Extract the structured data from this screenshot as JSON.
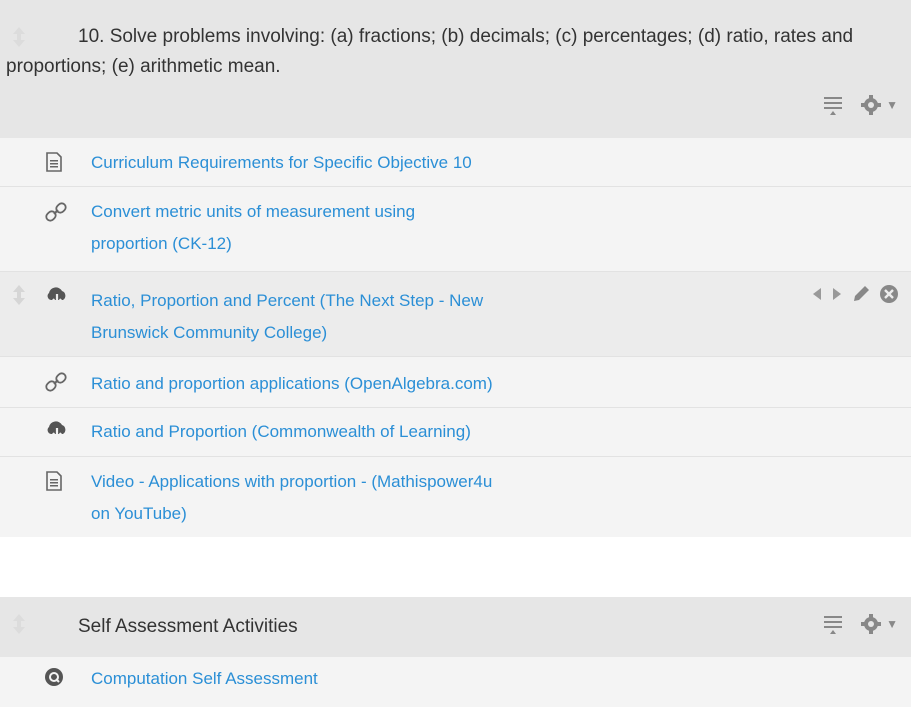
{
  "section1": {
    "title": "10. Solve problems involving: (a) fractions; (b) decimals; (c) percentages; (d) ratio, rates and proportions; (e) arithmetic mean.",
    "items": [
      {
        "icon": "document-icon",
        "line1": "Curriculum Requirements for Specific Objective 10",
        "line2": ""
      },
      {
        "icon": "link-icon",
        "line1": "Convert metric units of measurement using",
        "line2": "proportion (CK-12)"
      },
      {
        "icon": "cloud-download-icon",
        "line1": "Ratio, Proportion and Percent (The Next Step - New",
        "line2": "Brunswick Community College)"
      },
      {
        "icon": "link-icon",
        "line1": "Ratio and proportion applications (OpenAlgebra.com)",
        "line2": ""
      },
      {
        "icon": "cloud-download-icon",
        "line1": "Ratio and Proportion (Commonwealth of Learning)",
        "line2": ""
      },
      {
        "icon": "document-icon",
        "line1": "Video - Applications with proportion - (Mathispower4u",
        "line2": "on YouTube)"
      }
    ]
  },
  "section2": {
    "title": "Self Assessment Activities",
    "items": [
      {
        "icon": "quiz-icon",
        "line1": "Computation Self Assessment"
      }
    ]
  },
  "colors": {
    "link": "#2b8fd6",
    "header_bg": "#e6e6e6",
    "item_bg": "#f4f4f4",
    "icon": "#666666"
  }
}
